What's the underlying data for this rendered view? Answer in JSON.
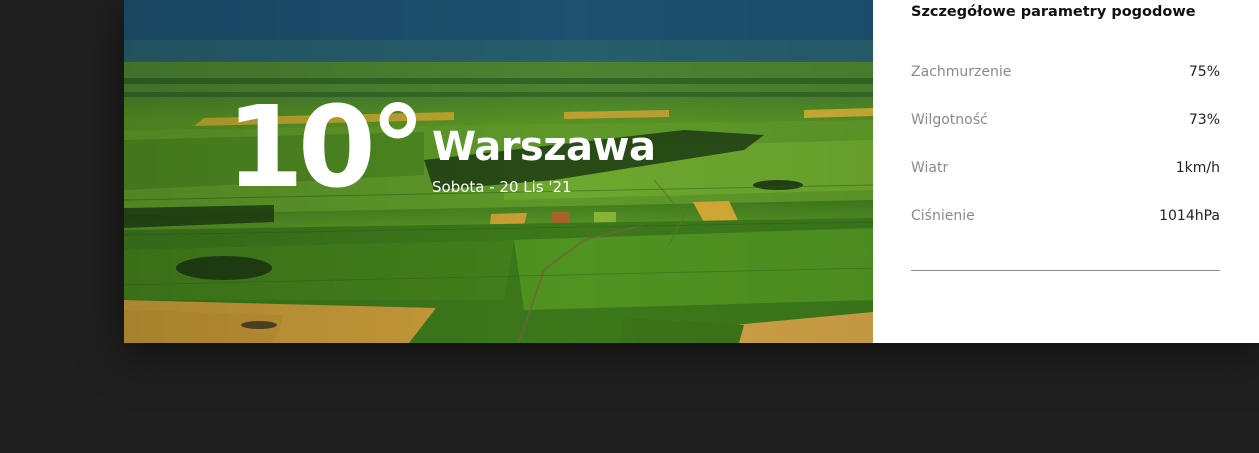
{
  "weather": {
    "temperature": "10°",
    "city": "Warszawa",
    "date": "Sobota - 20 Lis '21"
  },
  "details": {
    "title": "Szczegółowe parametry pogodowe",
    "params": [
      {
        "label": "Zachmurzenie",
        "value": "75%"
      },
      {
        "label": "Wilgotność",
        "value": "73%"
      },
      {
        "label": "Wiatr",
        "value": "1km/h"
      },
      {
        "label": "Ciśnienie",
        "value": "1014hPa"
      }
    ]
  }
}
